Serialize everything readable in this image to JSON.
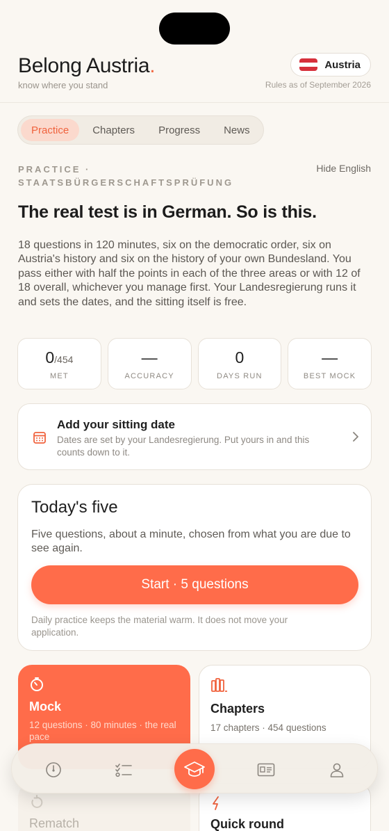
{
  "header": {
    "brand": "Belong Austria",
    "brand_dot": ".",
    "tagline": "know where you stand",
    "country": "Austria",
    "rules": "Rules as of September 2026",
    "flag_colors": [
      "#d6303b",
      "#ffffff",
      "#d6303b"
    ]
  },
  "tabs": [
    {
      "label": "Practice",
      "active": true
    },
    {
      "label": "Chapters",
      "active": false
    },
    {
      "label": "Progress",
      "active": false
    },
    {
      "label": "News",
      "active": false
    }
  ],
  "section": {
    "label_line1": "PRACTICE ·",
    "label_line2": "STAATSBÜRGERSCHAFTSPRÜFUNG",
    "hide_english": "Hide English"
  },
  "headline": "The real test is in German. So is this.",
  "intro": "18 questions in 120 minutes, six on the democratic order, six on Austria's history and six on the history of your own Bundesland. You pass either with half the points in each of the three areas or with 12 of 18 overall, whichever you manage first. Your Landesregierung runs it and sets the dates, and the sitting itself is free.",
  "stats": [
    {
      "value": "0",
      "suffix": "/454",
      "label": "MET"
    },
    {
      "value": "—",
      "suffix": "",
      "label": "ACCURACY"
    },
    {
      "value": "0",
      "suffix": "",
      "label": "DAYS RUN"
    },
    {
      "value": "—",
      "suffix": "",
      "label": "BEST MOCK"
    }
  ],
  "sitting": {
    "title": "Add your sitting date",
    "subtitle": "Dates are set by your Landesregierung. Put yours in and this counts down to it.",
    "icon": "calendar-icon"
  },
  "today": {
    "title": "Today's five",
    "subtitle": "Five questions, about a minute, chosen from what you are due to see again.",
    "button": "Start · 5 questions",
    "footnote": "Daily practice keeps the material warm. It does not move your application."
  },
  "cards": {
    "mock": {
      "title": "Mock",
      "subtitle": "12 questions · 80 minutes · the real pace",
      "icon": "timer-icon"
    },
    "chapters": {
      "title": "Chapters",
      "subtitle": "17 chapters · 454 questions",
      "icon": "books-icon"
    },
    "rematch": {
      "title": "Rematch",
      "icon": "redo-icon"
    },
    "quick": {
      "title": "Quick round",
      "icon": "lightning-icon"
    }
  },
  "nav": {
    "items": [
      "gauge-icon",
      "checklist-icon",
      "graduation-cap-icon",
      "id-card-icon",
      "person-icon"
    ],
    "active": "graduation-cap-icon"
  },
  "colors": {
    "accent": "#ff6c4a",
    "accent_soft": "#fbd9cd",
    "background": "#faf7f2"
  }
}
